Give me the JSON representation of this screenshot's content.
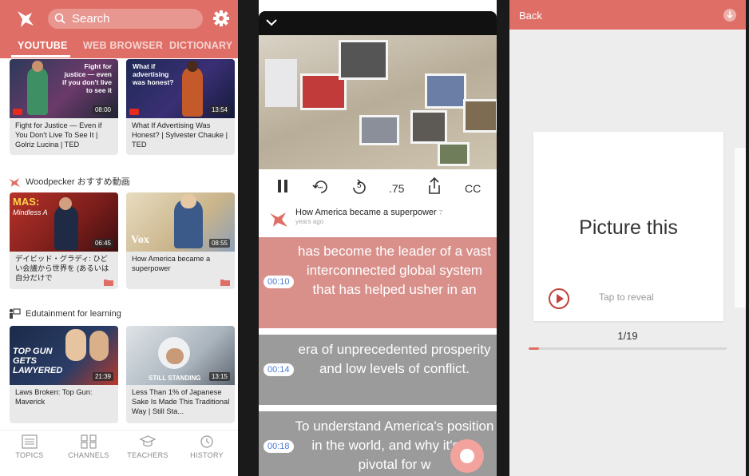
{
  "colors": {
    "brand": "#df6f66",
    "timestamp": "#4a7bd6"
  },
  "left_panel": {
    "search_placeholder": "Search",
    "tabs": [
      "YOUTUBE",
      "WEB BROWSER",
      "DICTIONARY"
    ],
    "sections": [
      {
        "title": "Woodpecker おすすめ動画"
      },
      {
        "title": "Edutainment for learning"
      }
    ],
    "cards": [
      {
        "title": "Fight for Justice — Even if You Don't Live To See It | Golriz Lucina | TED",
        "duration": "08:00",
        "overlay": "Fight for justice — even if you don't live to see it"
      },
      {
        "title": "What If Advertising Was Honest? | Sylvester Chauke | TED",
        "duration": "13:54",
        "overlay": "What if advertising was honest?"
      },
      {
        "title": "デイビッド・グラディ: ひどい会議から世界を (あるいは自分だけで",
        "duration": "06:45",
        "overlay": "MAS: Mindless A Syndrome"
      },
      {
        "title": "How America became a superpower",
        "duration": "08:55",
        "overlay": "Vox"
      },
      {
        "title": "Laws Broken: Top Gun: Maverick",
        "duration": "21:39",
        "overlay": "TOP GUN GETS LAWYERED"
      },
      {
        "title": "Less Than 1% of Japanese Sake Is Made This Traditional Way | Still Sta...",
        "duration": "13:15",
        "overlay": "STILL STANDING"
      }
    ],
    "nav": [
      "TOPICS",
      "CHANNELS",
      "TEACHERS",
      "HISTORY"
    ]
  },
  "middle_panel": {
    "controls": {
      "speed": ".75",
      "cc": "CC",
      "replay": "5"
    },
    "video_title": "How America became a superpower",
    "video_age_a": "7",
    "video_age_b": "years ago",
    "subtitles": [
      {
        "time": "00:10",
        "text": "has become the leader of a vast interconnected global system that has helped usher in an",
        "active": true
      },
      {
        "time": "00:14",
        "text": "era of unprecedented prosperity and low levels of conflict.",
        "active": false
      },
      {
        "time": "00:18",
        "text": "To understand America's position in the world, and why it's so pivotal for w",
        "active": false
      }
    ]
  },
  "right_panel": {
    "back_label": "Back",
    "card_word": "Picture this",
    "reveal_label": "Tap to reveal",
    "counter": "1/19",
    "progress_fraction": 0.053
  }
}
